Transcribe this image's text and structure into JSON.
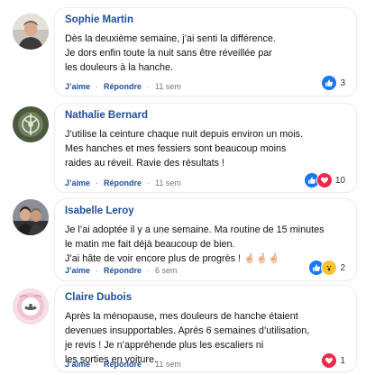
{
  "comments": [
    {
      "name": "Sophie Martin",
      "text": "Dès la deuxième semaine, j’ai senti la différence.\nJe dors enfin toute la nuit sans être réveillée par\nles douleurs à la hanche.",
      "like_label": "J’aime",
      "reply_label": "Répondre",
      "time": "11 sem",
      "reactions": [
        "like"
      ],
      "count": "3"
    },
    {
      "name": "Nathalie Bernard",
      "text": "J’utilise la ceinture chaque nuit depuis environ un mois.\nMes hanches et mes fessiers sont beaucoup moins\nraides au réveil. Ravie des résultats !",
      "like_label": "J’aime",
      "reply_label": "Répondre",
      "time": "11 sem",
      "reactions": [
        "like",
        "love"
      ],
      "count": "10"
    },
    {
      "name": "Isabelle Leroy",
      "text": "Je l’ai adoptée il y a une semaine. Ma routine de 15 minutes\nle matin me fait déjà beaucoup de bien.\nJ’ai hâte de voir encore plus de progrès ! 🤞🏻🤞🏻🤞🏻",
      "like_label": "J’aime",
      "reply_label": "Répondre",
      "time": "6 sem",
      "reactions": [
        "like",
        "wow"
      ],
      "count": "2"
    },
    {
      "name": "Claire Dubois",
      "text": "Après la ménopause, mes douleurs de hanche étaient\ndevenues insupportables. Après 6 semaines d’utilisation,\nje revis ! Je n’appréhende plus les escaliers ni\nles sorties en voiture.",
      "like_label": "J’aime",
      "reply_label": "Répondre",
      "time": "11 sem",
      "reactions": [
        "love"
      ],
      "count": "1"
    }
  ],
  "colors": {
    "name": "#1f4e9c",
    "like": "#1877f2",
    "love": "#f02849",
    "wow": "#f7c32e"
  },
  "icons": {
    "like": "thumbs-up-icon",
    "love": "heart-icon",
    "wow": "wow-face-icon"
  }
}
